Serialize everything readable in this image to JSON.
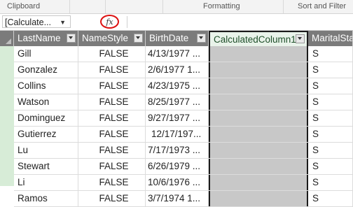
{
  "ribbon": {
    "groups": [
      "Clipboard",
      "Formatting",
      "Sort and Filter"
    ]
  },
  "formula_bar": {
    "name_box": "[Calculate...",
    "fx_label": "fx"
  },
  "table": {
    "columns": [
      "LastName",
      "NameStyle",
      "BirthDate",
      "CalculatedColumn1",
      "MaritalSta"
    ],
    "rows": [
      {
        "last": "Gill",
        "ns": "FALSE",
        "bd": "4/13/1977 ...",
        "calc": "",
        "ms": "S"
      },
      {
        "last": "Gonzalez",
        "ns": "FALSE",
        "bd": "2/6/1977 1...",
        "calc": "",
        "ms": "S"
      },
      {
        "last": "Collins",
        "ns": "FALSE",
        "bd": "4/23/1975 ...",
        "calc": "",
        "ms": "S"
      },
      {
        "last": "Watson",
        "ns": "FALSE",
        "bd": "8/25/1977 ...",
        "calc": "",
        "ms": "S"
      },
      {
        "last": "Dominguez",
        "ns": "FALSE",
        "bd": "9/27/1977 ...",
        "calc": "",
        "ms": "S"
      },
      {
        "last": "Gutierrez",
        "ns": "FALSE",
        "bd": "12/17/197...",
        "calc": "",
        "ms": "S"
      },
      {
        "last": "Lu",
        "ns": "FALSE",
        "bd": "7/17/1973 ...",
        "calc": "",
        "ms": "S"
      },
      {
        "last": "Stewart",
        "ns": "FALSE",
        "bd": "6/26/1979 ...",
        "calc": "",
        "ms": "S"
      },
      {
        "last": "Li",
        "ns": "FALSE",
        "bd": "10/6/1976 ...",
        "calc": "",
        "ms": "S"
      },
      {
        "last": "Ramos",
        "ns": "FALSE",
        "bd": "3/7/1974 1...",
        "calc": "",
        "ms": "S"
      }
    ]
  },
  "colors": {
    "header_bg": "#7b7b7b",
    "selected_column_header_bg": "#e9f3ea",
    "selected_column_cells_bg": "#c8c8c8",
    "row_selector_bg": "#d7ecd7",
    "fx_highlight": "#dd1111"
  },
  "icons": {
    "fx": "function-icon",
    "dropdown": "dropdown-arrow-icon"
  }
}
